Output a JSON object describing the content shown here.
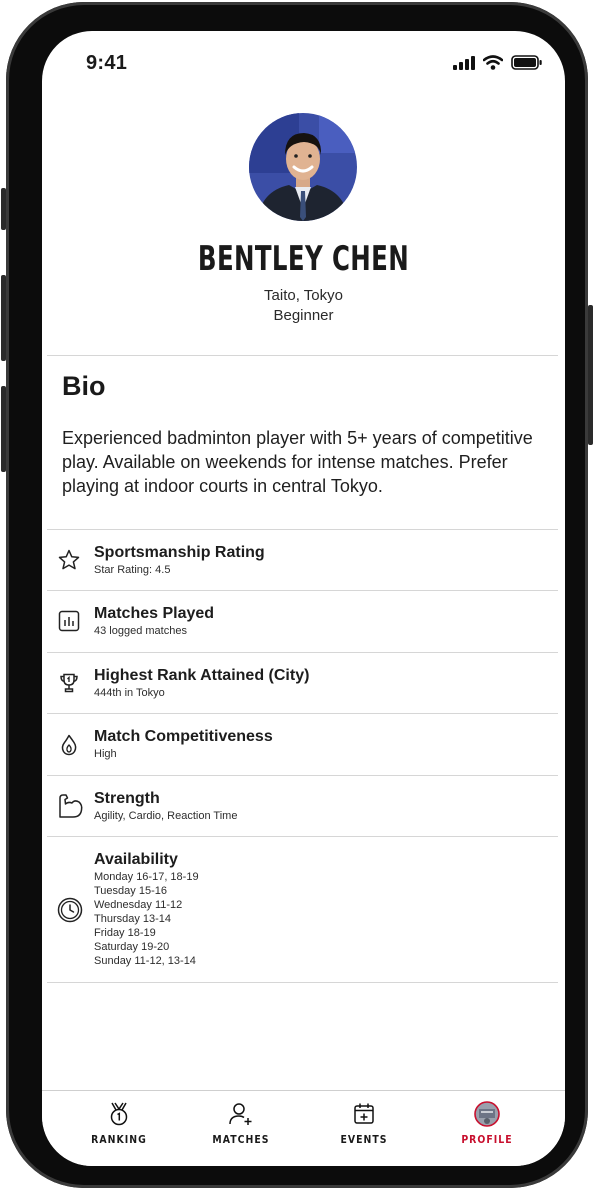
{
  "status_bar": {
    "time": "9:41"
  },
  "profile": {
    "name": "BENTLEY CHEN",
    "location": "Taito, Tokyo",
    "level": "Beginner"
  },
  "bio": {
    "title": "Bio",
    "text": "Experienced badminton player with 5+ years of competitive play. Available on weekends for intense matches. Prefer playing at indoor courts in central Tokyo."
  },
  "stats": [
    {
      "icon": "star-icon",
      "title": "Sportsmanship Rating",
      "subtitle": "Star Rating: 4.5"
    },
    {
      "icon": "bar-chart-icon",
      "title": "Matches Played",
      "subtitle": "43 logged matches"
    },
    {
      "icon": "trophy-icon",
      "title": "Highest Rank Attained (City)",
      "subtitle": "444th in Tokyo"
    },
    {
      "icon": "flame-icon",
      "title": "Match Competitiveness",
      "subtitle": "High"
    },
    {
      "icon": "muscle-arm-icon",
      "title": "Strength",
      "subtitle": "Agility, Cardio, Reaction Time"
    }
  ],
  "availability": {
    "icon": "clock-icon",
    "title": "Availability",
    "slots": [
      "Monday 16-17, 18-19",
      "Tuesday 15-16",
      "Wednesday 11-12",
      "Thursday 13-14",
      "Friday 18-19",
      "Saturday 19-20",
      "Sunday 11-12, 13-14"
    ]
  },
  "tabs": [
    {
      "label": "RANKING",
      "icon": "medal-icon",
      "active": false
    },
    {
      "label": "MATCHES",
      "icon": "add-user-icon",
      "active": false
    },
    {
      "label": "EVENTS",
      "icon": "calendar-plus-icon",
      "active": false
    },
    {
      "label": "PROFILE",
      "icon": "avatar-icon",
      "active": true
    }
  ],
  "colors": {
    "accent": "#c8102e",
    "divider": "#d6d6d6",
    "text": "#1a1a1a"
  }
}
